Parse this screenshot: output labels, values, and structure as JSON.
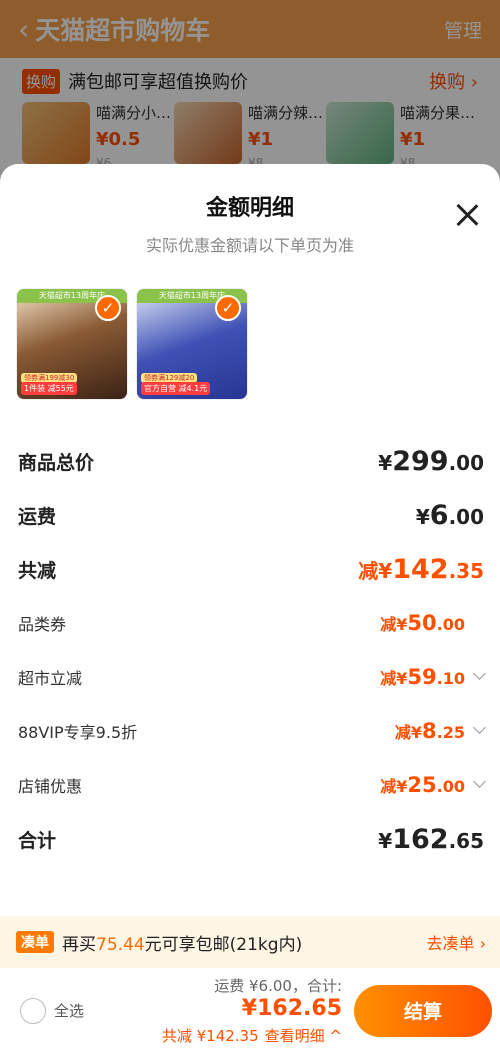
{
  "background": {
    "header": {
      "back_glyph": "‹",
      "title": "天猫超市购物车",
      "manage": "管理"
    },
    "swap": {
      "tag": "换购",
      "text": "满包邮可享超值换购价",
      "link": "换购 ›",
      "items": [
        {
          "name": "喵满分小…",
          "price": "¥0.5",
          "orig": "¥6"
        },
        {
          "name": "喵满分辣…",
          "price": "¥1",
          "orig": "¥8"
        },
        {
          "name": "喵满分果…",
          "price": "¥1",
          "orig": "¥8"
        }
      ]
    }
  },
  "sheet": {
    "title": "金额明细",
    "subtitle": "实际优惠金额请以下单页为准",
    "thumbnails": [
      {
        "band": "天猫超市13周年庆",
        "promo_top": "领券满199减30",
        "promo": "1件装 减55元"
      },
      {
        "band": "天猫超市13周年庆",
        "promo_top": "领券满129减20",
        "promo": "官方自营 减4.1元"
      }
    ],
    "check_glyph": "✓",
    "rows": [
      {
        "label": "商品总价",
        "prefix": "",
        "yen": "¥",
        "int": "299",
        "dec": ".00"
      },
      {
        "label": "运费",
        "prefix": "",
        "yen": "¥",
        "int": "6",
        "dec": ".00"
      },
      {
        "label": "共减",
        "prefix": "减",
        "yen": "¥",
        "int": "142",
        "dec": ".35"
      },
      {
        "label": "品类券",
        "prefix": "减",
        "yen": "¥",
        "int": "50",
        "dec": ".00"
      },
      {
        "label": "超市立减",
        "prefix": "减",
        "yen": "¥",
        "int": "59",
        "dec": ".10"
      },
      {
        "label": "88VIP专享9.5折",
        "prefix": "减",
        "yen": "¥",
        "int": "8",
        "dec": ".25"
      },
      {
        "label": "店铺优惠",
        "prefix": "减",
        "yen": "¥",
        "int": "25",
        "dec": ".00"
      },
      {
        "label": "合计",
        "prefix": "",
        "yen": "¥",
        "int": "162",
        "dec": ".65"
      }
    ]
  },
  "freeship": {
    "tag": "凑单",
    "text_before": "再买",
    "amount": "75.44",
    "text_after": "元可享包邮(21kg内)",
    "link": "去凑单 ›"
  },
  "checkout": {
    "select_all": "全选",
    "shipping": "运费 ¥6.00，合计:",
    "total": "¥162.65",
    "discount": "共减 ¥142.35",
    "detail": "查看明细 ^",
    "button": "结算"
  },
  "colors": {
    "accent": "#ff5000",
    "header_bg": "#f7a14a"
  }
}
